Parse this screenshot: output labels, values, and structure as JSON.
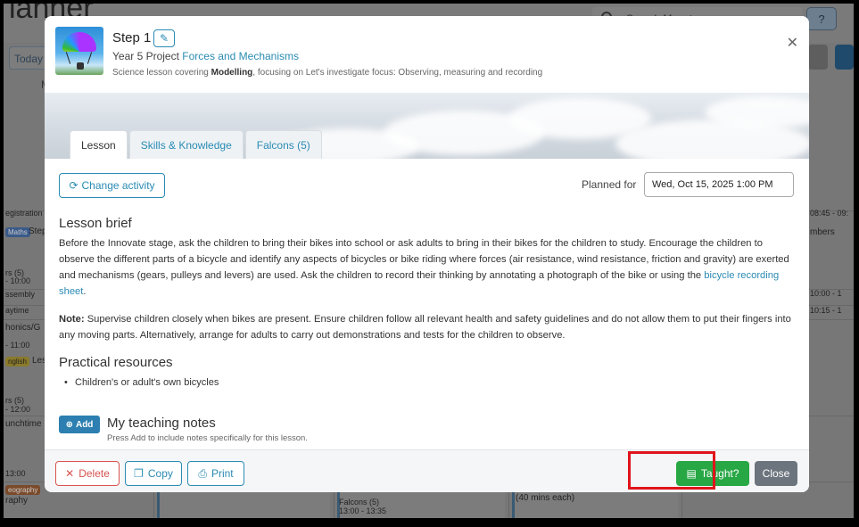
{
  "background": {
    "title_fragment": "lanner",
    "search_placeholder": "Search Maestro",
    "help_label": "?",
    "today_label": "Today",
    "day_letter": "M",
    "left_texts": [
      "egistration",
      "Maths",
      "Step",
      "rs (5)",
      "- 10:00",
      "ssembly",
      "aytime",
      "honics/G",
      "nglish",
      "Les",
      "- 11:00",
      "rs (5)",
      "- 12:00",
      "unchtime",
      "13:00",
      "eography",
      "raphy"
    ],
    "right_texts": [
      "08:45 - 09:",
      "mbers",
      "10:00 - 1",
      "10:15 - 1"
    ],
    "bottom_texts": [
      "Falcons (5)",
      "13:00 - 13:35",
      "(40 mins each)"
    ]
  },
  "modal": {
    "step_title": "Step 1",
    "project_prefix": "Year 5 Project",
    "project_link": "Forces and Mechanisms",
    "description_prefix": "Science lesson covering ",
    "description_bold": "Modelling",
    "description_suffix": ", focusing on Let's investigate focus: Observing, measuring and recording",
    "tabs": [
      {
        "label": "Lesson",
        "active": true
      },
      {
        "label": "Skills & Knowledge",
        "active": false
      },
      {
        "label": "Falcons (5)",
        "active": false
      }
    ],
    "change_activity_label": "Change activity",
    "planned_for_label": "Planned for",
    "planned_for_value": "Wed, Oct 15, 2025 1:00 PM",
    "lesson_brief_heading": "Lesson brief",
    "lesson_brief_text": "Before the Innovate stage, ask the children to bring their bikes into school or ask adults to bring in their bikes for the children to study. Encourage the children to observe the different parts of a bicycle and identify any aspects of bicycles or bike riding where forces (air resistance, wind resistance, friction and gravity) are exerted and mechanisms (gears, pulleys and levers) are used. Ask the children to record their thinking by annotating a photograph of the bike or using the ",
    "lesson_brief_link": "bicycle recording sheet",
    "lesson_brief_end": ".",
    "note_label": "Note:",
    "note_text": " Supervise children closely when bikes are present. Ensure children follow all relevant health and safety guidelines and do not allow them to put their fingers into any moving parts. Alternatively, arrange for adults to carry out demonstrations and tests for the children to observe.",
    "practical_heading": "Practical resources",
    "practical_items": [
      "Children's or adult's own bicycles"
    ],
    "add_label": "Add",
    "notes_heading": "My teaching notes",
    "notes_sub": "Press Add to include notes specifically for this lesson.",
    "footer": {
      "delete_label": "Delete",
      "copy_label": "Copy",
      "print_label": "Print",
      "taught_label": "Taught?",
      "close_label": "Close"
    }
  },
  "colors": {
    "accent": "#2a8bb3",
    "danger": "#d9534f",
    "success": "#28a745",
    "secondary": "#6c757d",
    "highlight": "#e0141c"
  }
}
